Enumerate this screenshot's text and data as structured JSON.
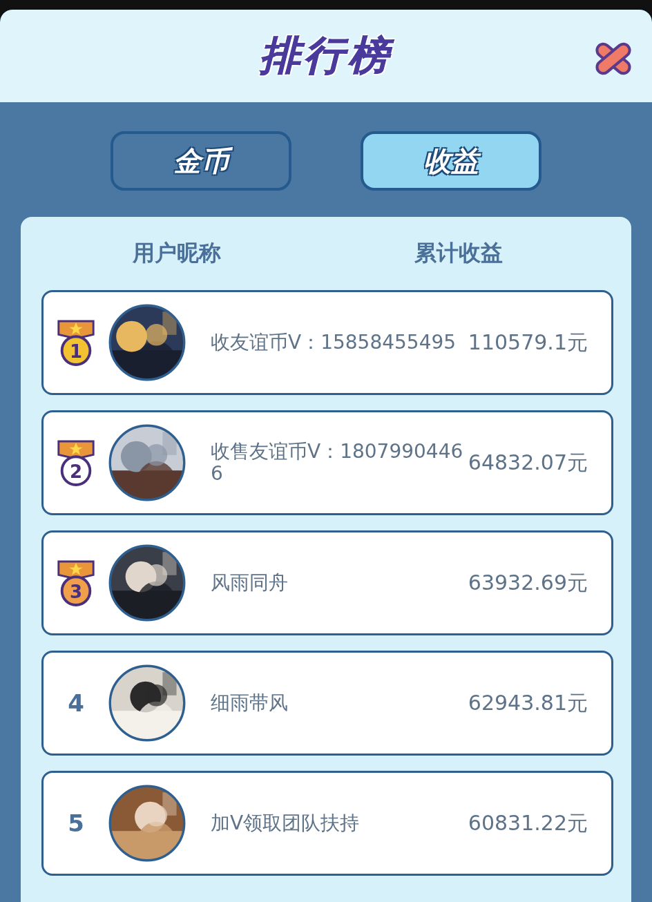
{
  "dialog": {
    "title": "排行榜"
  },
  "tabs": [
    {
      "label": "金币",
      "selected": false
    },
    {
      "label": "收益",
      "selected": true
    }
  ],
  "table": {
    "columns": [
      "用户昵称",
      "累计收益"
    ],
    "rows": [
      {
        "rank": "1",
        "kind": "medal",
        "color": "#f2c230",
        "name": "收友谊币V：15858455495",
        "amount": "110579.1元"
      },
      {
        "rank": "2",
        "kind": "medal",
        "color": "#ffffff",
        "name": "收售友谊币V：18079904466",
        "amount": "64832.07元"
      },
      {
        "rank": "3",
        "kind": "medal",
        "color": "#f0a04a",
        "name": "风雨同舟",
        "amount": "63932.69元"
      },
      {
        "rank": "4",
        "kind": "number",
        "name": "细雨带风",
        "amount": "62943.81元"
      },
      {
        "rank": "5",
        "kind": "number",
        "name": "加V领取团队扶持",
        "amount": "60831.22元"
      }
    ]
  }
}
